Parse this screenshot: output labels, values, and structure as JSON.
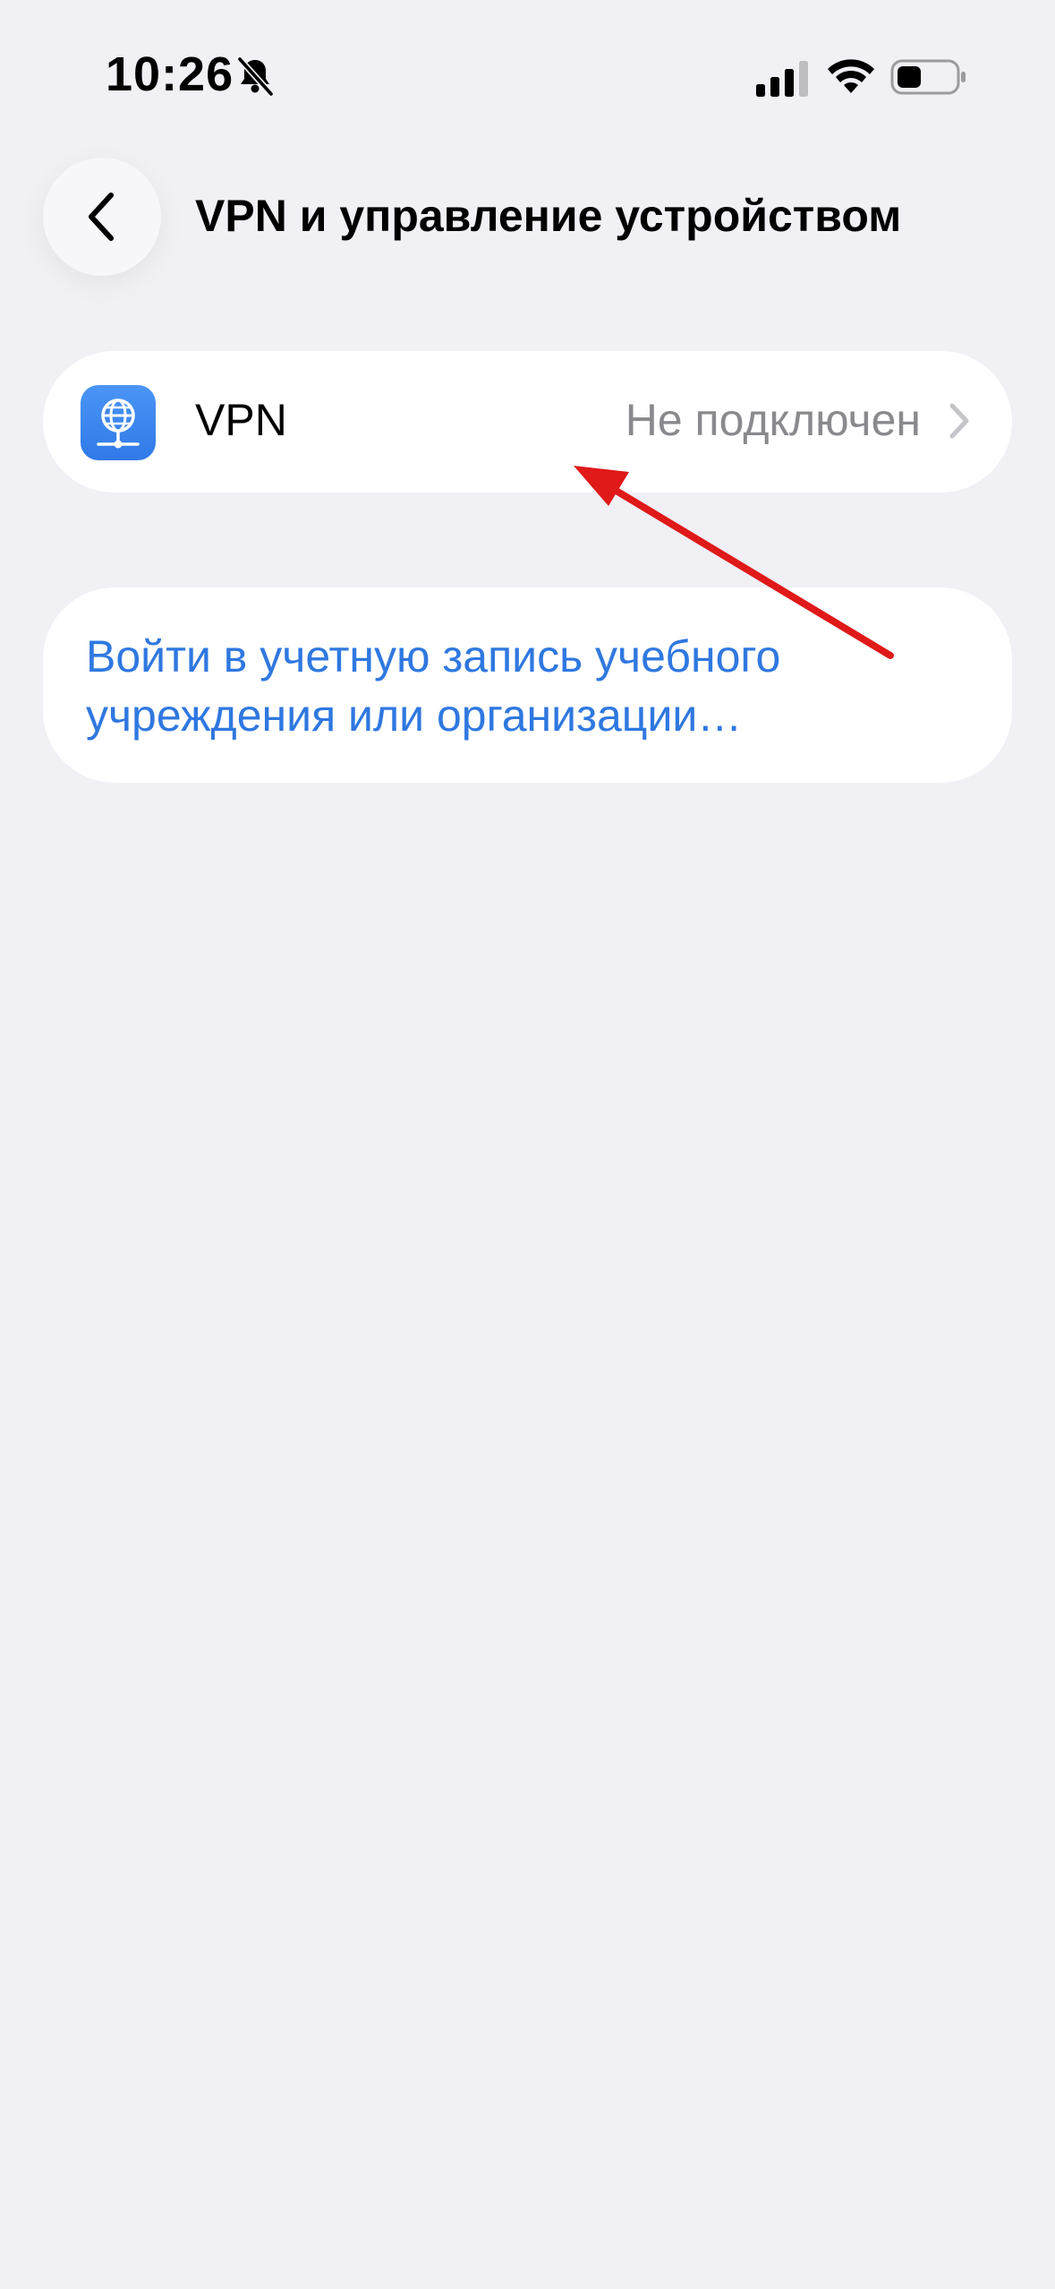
{
  "status_bar": {
    "time": "10:26",
    "icons": [
      "bell-slash-icon",
      "cellular-signal-icon",
      "wifi-icon",
      "battery-icon"
    ]
  },
  "header": {
    "title": "VPN и управление устройством",
    "back_icon": "chevron-left-icon"
  },
  "vpn_row": {
    "icon": "globe-network-icon",
    "label": "VPN",
    "status": "Не подключен",
    "chevron_icon": "chevron-right-icon"
  },
  "signin": {
    "link_text": "Войти в учетную запись учебного учреждения или организации…"
  },
  "colors": {
    "background": "#f0f0f5",
    "card": "#ffffff",
    "link_blue": "#2f78e0",
    "secondary_text": "#8a8a8e",
    "vpn_icon_blue": "#3b86ee",
    "annotation_red": "#e01919"
  }
}
